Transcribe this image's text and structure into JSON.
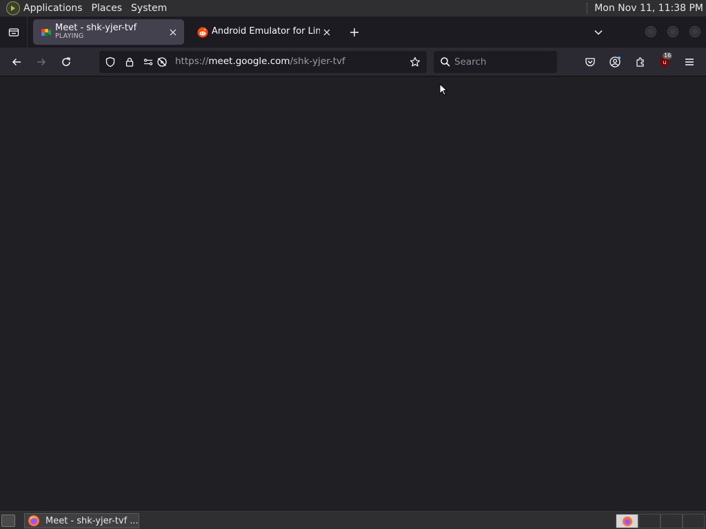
{
  "system_panel": {
    "menus": [
      "Applications",
      "Places",
      "System"
    ],
    "clock": "Mon Nov 11, 11:38 PM"
  },
  "tabs": [
    {
      "title": "Meet - shk-yjer-tvf",
      "subtitle": "PLAYING",
      "active": true,
      "favicon": "google-meet-icon"
    },
    {
      "title": "Android Emulator for Linux",
      "active": false,
      "favicon": "reddit-icon"
    }
  ],
  "navbar": {
    "url_prefix": "https://",
    "url_domain": "meet.google.com",
    "url_path": "/shk-yjer-tvf",
    "search_placeholder": "Search",
    "extension_badge": "16"
  },
  "taskbar": {
    "window_label": "Meet - shk-yjer-tvf ..."
  },
  "colors": {
    "chrome_dark": "#1c1b22",
    "toolbar": "#2b2a33",
    "active_tab": "#42414d",
    "content": "#202024",
    "panel": "#2f2f31"
  }
}
